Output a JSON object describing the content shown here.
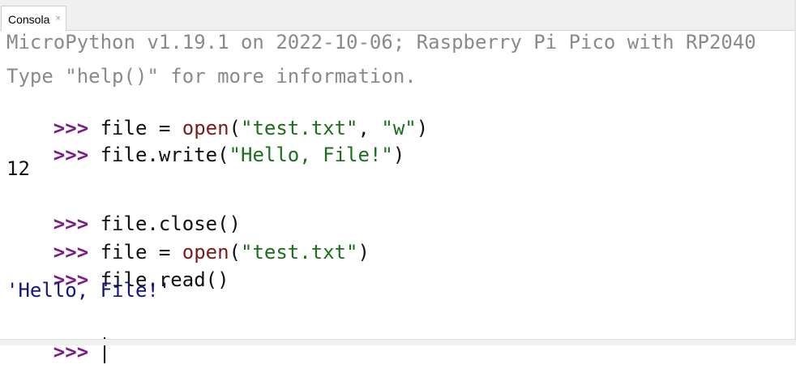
{
  "tab": {
    "label": "Consola",
    "close": "×"
  },
  "console": {
    "banner1": "MicroPython v1.19.1 on 2022-10-06; Raspberry Pi Pico with RP2040",
    "banner2": "Type \"help()\" for more information.",
    "prompt": ">>> ",
    "l1": {
      "a": "file = ",
      "b": "open",
      "c": "(",
      "d": "\"test.txt\"",
      "e": ", ",
      "f": "\"w\"",
      "g": ")"
    },
    "l2": {
      "a": "file.write(",
      "b": "\"Hello, File!\"",
      "c": ")"
    },
    "out1": "12",
    "l3": {
      "a": "file.close()"
    },
    "l4": {
      "a": "file = ",
      "b": "open",
      "c": "(",
      "d": "\"test.txt\"",
      "e": ")"
    },
    "l5": {
      "a": "file.read()"
    },
    "out2": "'Hello, File!'"
  }
}
